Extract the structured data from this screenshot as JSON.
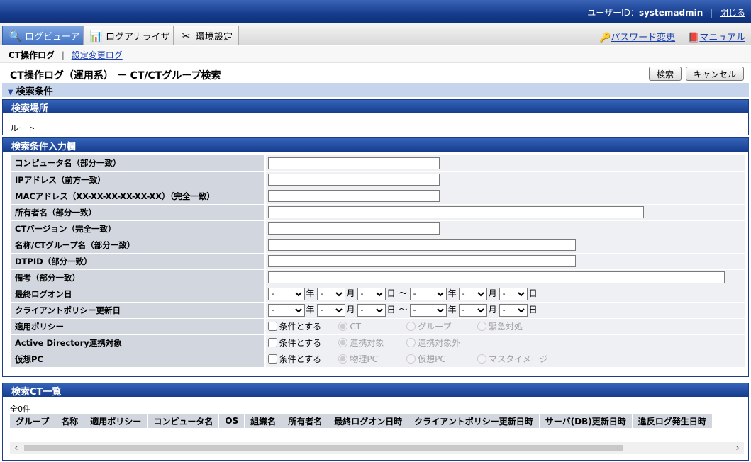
{
  "header": {
    "user_id_label": "ユーザーID：",
    "user_id": "systemadmin",
    "close_label": "閉じる"
  },
  "tabs": [
    {
      "label": "ログビューア",
      "icon": "log-viewer-icon",
      "active": true
    },
    {
      "label": "ログアナライザ",
      "icon": "log-analyzer-icon",
      "active": false
    },
    {
      "label": "環境設定",
      "icon": "tools-icon",
      "active": false
    }
  ],
  "toplinks": {
    "password_change": "パスワード変更",
    "manual": "マニュアル"
  },
  "subnav": {
    "current": "CT操作ログ",
    "link": "設定変更ログ"
  },
  "page": {
    "title": "CT操作ログ（運用系） － CT/CTグループ検索",
    "search_button": "検索",
    "cancel_button": "キャンセル"
  },
  "conditions_header": "検索条件",
  "location": {
    "title": "検索場所",
    "value": "ルート"
  },
  "form": {
    "title": "検索条件入力欄",
    "computer_name": "コンピュータ名（部分一致）",
    "ip_address": "IPアドレス（前方一致）",
    "mac_address": "MACアドレス（XX-XX-XX-XX-XX-XX）（完全一致）",
    "owner_name": "所有者名（部分一致）",
    "ct_version": "CTバージョン（完全一致）",
    "group_name": "名称/CTグループ名（部分一致）",
    "dtpid": "DTPID（部分一致）",
    "remarks": "備考（部分一致）",
    "last_logon": "最終ログオン日",
    "policy_update": "クライアントポリシー更新日",
    "applied_policy": "適用ポリシー",
    "ad_target": "Active Directory連携対象",
    "virtual_pc": "仮想PC",
    "date_default": "-",
    "unit_year": "年",
    "unit_month": "月",
    "unit_day": "日",
    "range_sep": "～",
    "condition_checkbox": "条件とする",
    "policy_options": [
      "CT",
      "グループ",
      "緊急対処"
    ],
    "ad_options": [
      "連携対象",
      "連携対象外"
    ],
    "vpc_options": [
      "物理PC",
      "仮想PC",
      "マスタイメージ"
    ]
  },
  "list": {
    "title": "検索CT一覧",
    "count": "全0件",
    "columns": [
      "グループ",
      "名称",
      "適用ポリシー",
      "コンピュータ名",
      "OS",
      "組織名",
      "所有者名",
      "最終ログオン日時",
      "クライアントポリシー更新日時",
      "サーバ(DB)更新日時",
      "違反ログ発生日時"
    ]
  }
}
